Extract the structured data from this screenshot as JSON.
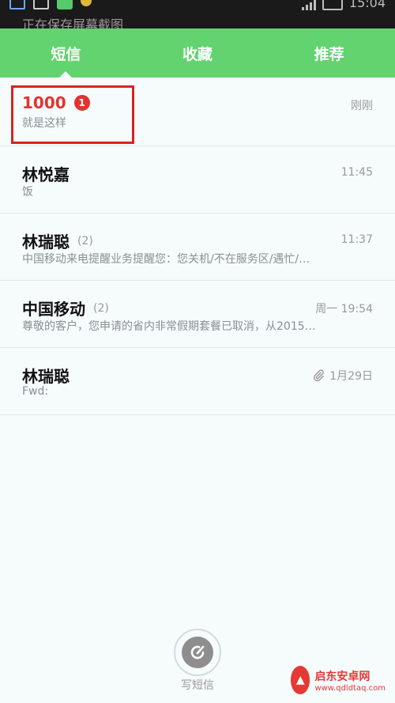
{
  "status_bar": {
    "notification": "正在保存屏幕截图",
    "time": "15:04"
  },
  "tabs": [
    {
      "label": "短信",
      "active": true
    },
    {
      "label": "收藏",
      "active": false
    },
    {
      "label": "推荐",
      "active": false
    }
  ],
  "messages": [
    {
      "name": "1000",
      "count": "",
      "badge": "1",
      "preview": "就是这样",
      "time": "刚刚"
    },
    {
      "name": "林悦嘉",
      "count": "",
      "preview": "饭",
      "time": "11:45"
    },
    {
      "name": "林瑞聪",
      "count": "(2)",
      "preview": "中国移动来电提醒业务提醒您：您关机/不在服务区/遇忙/…",
      "time": "11:37"
    },
    {
      "name": "中国移动",
      "count": "(2)",
      "preview": "尊敬的客户，您申请的省内非常假期套餐已取消，从2015…",
      "time": "周一 19:54"
    },
    {
      "name": "林瑞聪",
      "count": "",
      "preview": "Fwd:",
      "time": "1月29日",
      "attachment_icon": "paperclip-icon"
    }
  ],
  "compose": {
    "label": "写短信"
  },
  "watermark": {
    "title": "启东安卓网",
    "url": "www.qdldtaq.com"
  },
  "colors": {
    "tab_bar": "#62d36e",
    "unread_red": "#e2342f",
    "highlight_box": "#d7241f"
  }
}
